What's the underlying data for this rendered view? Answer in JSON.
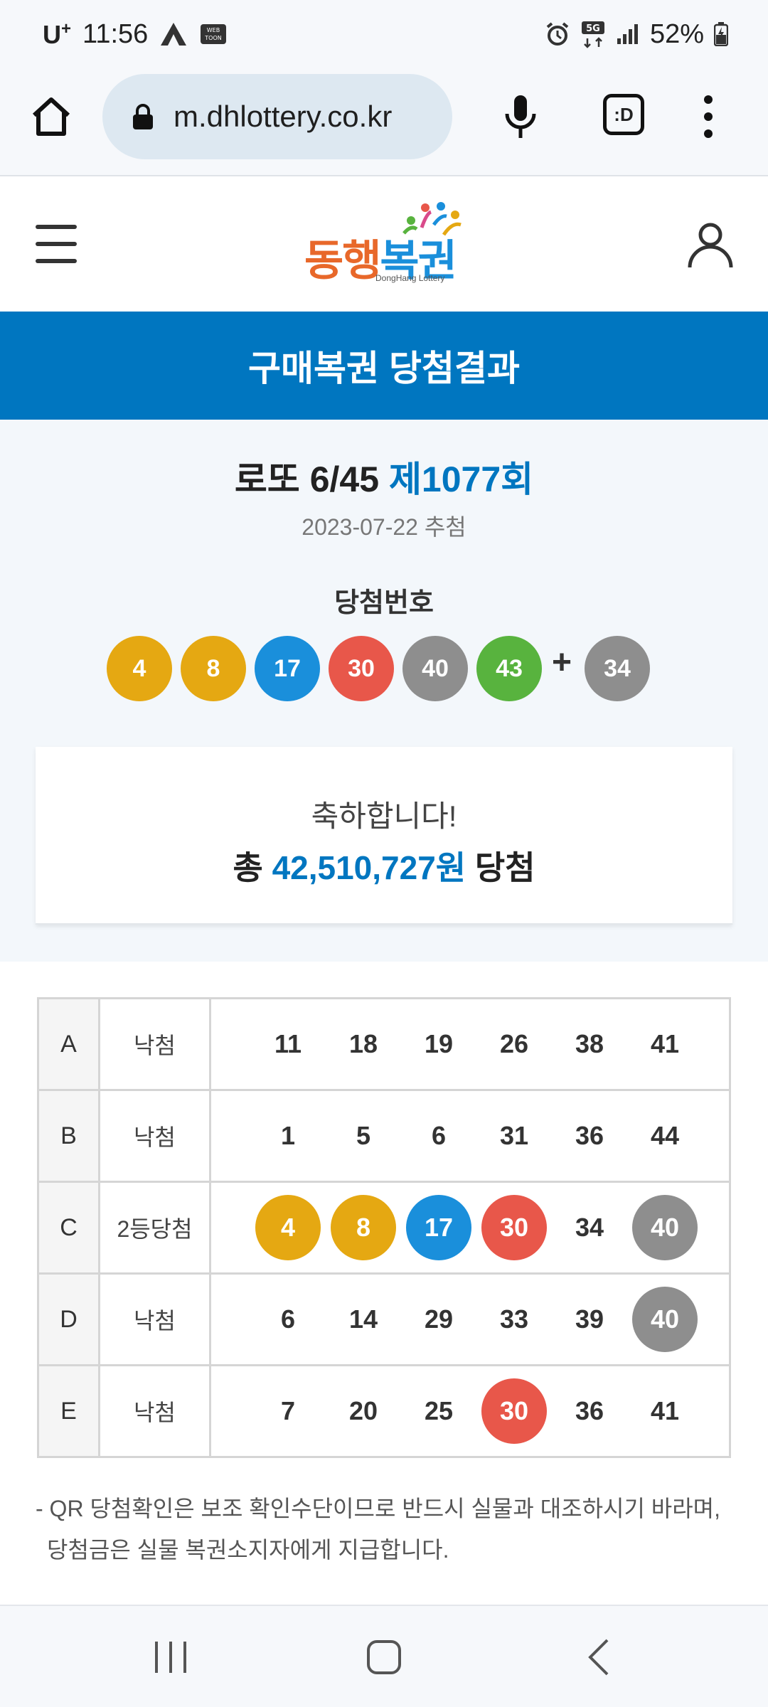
{
  "status_bar": {
    "carrier": "U",
    "carrier_mark": "+",
    "time": "11:56",
    "network": "5G",
    "battery": "52%"
  },
  "browser": {
    "url": "m.dhlottery.co.kr",
    "tabs_label": ":D"
  },
  "site": {
    "logo_text": "동행복권",
    "logo_subtext": "DongHang Lottery"
  },
  "page": {
    "title": "구매복권 당첨결과"
  },
  "draw": {
    "game": "로또 6/45",
    "round": "제1077회",
    "date": "2023-07-22 추첨",
    "winning_label": "당첨번호",
    "winning_numbers": [
      "4",
      "8",
      "17",
      "30",
      "40",
      "43"
    ],
    "plus_sign": "+",
    "bonus_number": "34"
  },
  "summary": {
    "message": "축하합니다!",
    "prefix": "총",
    "amount": "42,510,727원",
    "suffix": "당첨"
  },
  "results": [
    {
      "game": "A",
      "result": "낙첨",
      "numbers": [
        "11",
        "18",
        "19",
        "26",
        "38",
        "41"
      ],
      "hits": [
        false,
        false,
        false,
        false,
        false,
        false
      ]
    },
    {
      "game": "B",
      "result": "낙첨",
      "numbers": [
        "1",
        "5",
        "6",
        "31",
        "36",
        "44"
      ],
      "hits": [
        false,
        false,
        false,
        false,
        false,
        false
      ]
    },
    {
      "game": "C",
      "result": "2등당첨",
      "numbers": [
        "4",
        "8",
        "17",
        "30",
        "34",
        "40"
      ],
      "hits": [
        true,
        true,
        true,
        true,
        false,
        true
      ]
    },
    {
      "game": "D",
      "result": "낙첨",
      "numbers": [
        "6",
        "14",
        "29",
        "33",
        "39",
        "40"
      ],
      "hits": [
        false,
        false,
        false,
        false,
        false,
        true
      ]
    },
    {
      "game": "E",
      "result": "낙첨",
      "numbers": [
        "7",
        "20",
        "25",
        "30",
        "36",
        "41"
      ],
      "hits": [
        false,
        false,
        false,
        true,
        false,
        false
      ]
    }
  ],
  "notice": "- QR 당첨확인은 보조 확인수단이므로 반드시 실물과 대조하시기 바라며, 당첨금은 실물 복권소지자에게 지급합니다.",
  "colors": {
    "accent": "#0076c0",
    "ball_1_10": "#e5a812",
    "ball_11_20": "#1a8fdb",
    "ball_21_30": "#e8574a",
    "ball_31_40": "#8e8e8e",
    "ball_41_45": "#58b33e"
  },
  "icons": {
    "home": "home-icon",
    "lock": "lock-icon",
    "mic": "mic-icon",
    "more": "more-vert-icon",
    "menu": "hamburger-icon",
    "user": "user-icon",
    "recent": "recent-apps-icon",
    "home_nav": "home-nav-icon",
    "back": "back-icon"
  }
}
